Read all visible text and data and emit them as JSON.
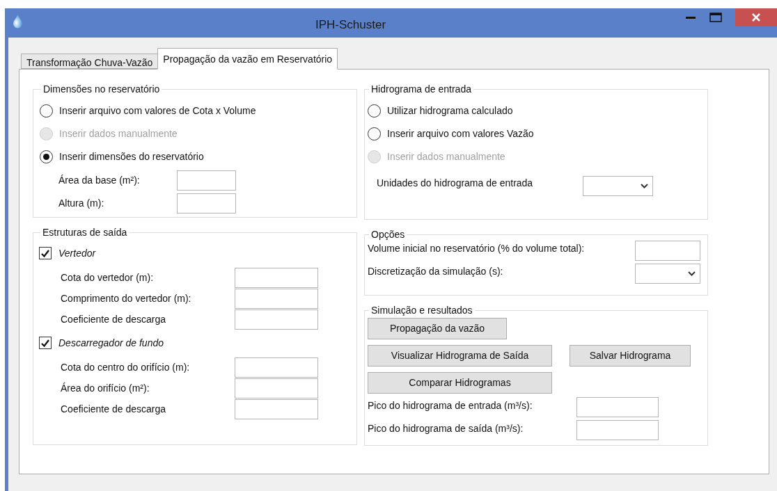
{
  "window": {
    "title": "IPH-Schuster"
  },
  "tabs": [
    {
      "label": "Transformação Chuva-Vazão",
      "selected": false
    },
    {
      "label": "Propagação da vazão em Reservatório",
      "selected": true
    }
  ],
  "dimensions": {
    "title": "Dimensões no reservatório",
    "options": [
      {
        "label": "Inserir arquivo com valores de Cota x Volume",
        "selected": false,
        "disabled": false
      },
      {
        "label": "Inserir dados manualmente",
        "selected": false,
        "disabled": true
      },
      {
        "label": "Inserir dimensões do reservatório",
        "selected": true,
        "disabled": false
      }
    ],
    "fields": [
      {
        "label": "Área da base (m²):"
      },
      {
        "label": "Altura (m):"
      }
    ]
  },
  "outlet_structures": {
    "title": "Estruturas de saída",
    "sections": [
      {
        "label": "Vertedor",
        "checked": true,
        "fields": [
          {
            "label": "Cota do vertedor (m):"
          },
          {
            "label": "Comprimento do vertedor (m):"
          },
          {
            "label": "Coeficiente de descarga"
          }
        ]
      },
      {
        "label": "Descarregador de fundo",
        "checked": true,
        "fields": [
          {
            "label": "Cota do centro do orifício (m):"
          },
          {
            "label": "Área do orifício (m²):"
          },
          {
            "label": "Coeficiente de descarga"
          }
        ]
      }
    ]
  },
  "inflow_hydrograph": {
    "title": "Hidrograma de entrada",
    "options": [
      {
        "label": "Utilizar hidrograma calculado",
        "selected": false,
        "disabled": false
      },
      {
        "label": "Inserir arquivo com valores Vazão",
        "selected": false,
        "disabled": false
      },
      {
        "label": "Inserir dados manualmente",
        "selected": false,
        "disabled": true
      }
    ],
    "units_label": "Unidades do hidrograma de entrada"
  },
  "options": {
    "title": "Opções",
    "fields": [
      {
        "label": "Volume inicial no reservatório (% do volume total):",
        "kind": "text"
      },
      {
        "label": "Discretização da simulação (s):",
        "kind": "select"
      }
    ]
  },
  "simulation": {
    "title": "Simulação e resultados",
    "button_rows": [
      [
        "Propagação da vazão"
      ],
      [
        "Visualizar Hidrograma de Saída",
        "Salvar Hidrograma"
      ],
      [
        "Comparar Hidrogramas"
      ]
    ],
    "fields": [
      {
        "label": "Pico do hidrograma de entrada (m³/s):"
      },
      {
        "label": "Pico do hidrograma de saída (m³/s):"
      }
    ]
  }
}
